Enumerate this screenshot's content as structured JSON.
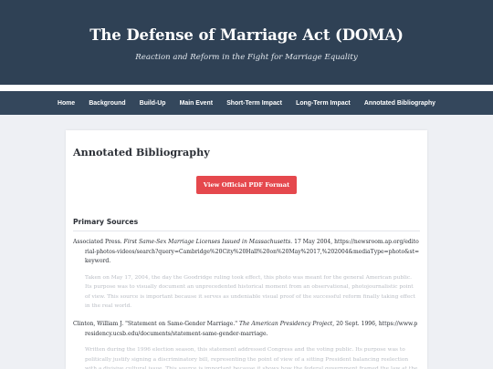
{
  "header": {
    "title": "The Defense of Marriage Act (DOMA)",
    "subtitle": "Reaction and Reform in the Fight for Marriage Equality"
  },
  "nav": {
    "items": [
      {
        "label": "Home"
      },
      {
        "label": "Background"
      },
      {
        "label": "Build-Up"
      },
      {
        "label": "Main Event"
      },
      {
        "label": "Short-Term Impact"
      },
      {
        "label": "Long-Term Impact"
      },
      {
        "label": "Annotated Bibliography"
      }
    ]
  },
  "main": {
    "title": "Annotated Bibliography",
    "pdf_button_label": "View Official PDF Format",
    "primary_sources": {
      "heading": "Primary Sources",
      "entries": [
        {
          "author": "Associated Press.",
          "title": "First Same-Sex Marriage Licenses Issued in Massachusetts.",
          "date": "17 May 2004,",
          "url": "https://newsroom.ap.org/editorial-photos-videos/search?query=Cambridge%20City%20Hall%20on%20May%2017,%202004&mediaType=photo&st=keyword.",
          "annotation": "Taken on May 17, 2004, the day the Goodridge ruling took effect, this photo was meant for the general American public. Its purpose was to visually document an unprecedented historical moment from an observational, photojournalistic point of view. This source is important because it serves as undeniable visual proof of the successful reform finally taking effect in the real world."
        },
        {
          "author": "Clinton, William J.",
          "title": "\"Statement on Same-Gender Marriage.\"",
          "container": "The American Presidency Project,",
          "date": "20 Sept. 1996,",
          "url": "https://www.presidency.ucsb.edu/documents/statement-same-gender-marriage.",
          "annotation": "Written during the 1996 election season, this statement addressed Congress and the voting public. Its purpose was to politically justify signing a discriminatory bill, representing the point of view of a sitting President balancing reelection with a divisive cultural issue. This source is important because it shows how the federal government framed the law at the moment it was enacted."
        }
      ]
    }
  },
  "colors": {
    "header_bg": "#2f4155",
    "nav_bg": "#34475c",
    "page_bg": "#eef0f4",
    "button_bg": "#e5484d",
    "annotation_text": "#b9bdc4"
  }
}
